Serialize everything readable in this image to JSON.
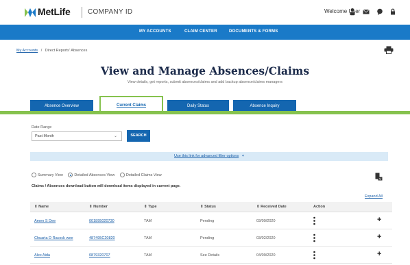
{
  "header": {
    "brand": "MetLife",
    "product": "COMPANY ID",
    "welcome": "Welcome User",
    "brand_colors": {
      "blue": "#1a7ac8",
      "green": "#86c24e"
    },
    "icons": [
      "user-icon",
      "mail-icon",
      "chat-icon",
      "lock-icon"
    ]
  },
  "nav": {
    "items": [
      "MY ACCOUNTS",
      "CLAIM CENTER",
      "DOCUMENTS & FORMS"
    ]
  },
  "breadcrumb": {
    "root": "My Accounts",
    "separator": "/",
    "current": "Direct Reports' Absences"
  },
  "page": {
    "title": "View and Manage Absences/Claims",
    "subtitle": "View details, get reports, submit absences/claims and add backup absence/claims managers"
  },
  "tabs": [
    {
      "label": "Absence Overview",
      "active": false
    },
    {
      "label": "Current Claims",
      "active": true
    },
    {
      "label": "Daily Status",
      "active": false
    },
    {
      "label": "Absence Inquiry",
      "active": false
    }
  ],
  "filters": {
    "date_range_label": "Date Range",
    "date_range_value": "Past Month",
    "search_label": "SEARCH",
    "advanced_link": "Use this link for advanced filter options",
    "advanced_icon": "+"
  },
  "views": {
    "options": [
      "Summary View",
      "Detailed Absences View",
      "Detailed Claims View"
    ],
    "selected": "Detailed Absences View"
  },
  "note": "Claims / Absences download button will download items displayed in current page.",
  "expand_all": "Expand All",
  "table": {
    "headers": [
      "Name",
      "Number",
      "Type",
      "Status",
      "Received Date",
      "Action"
    ],
    "sort_glyph": "⇕",
    "rows": [
      {
        "name": "Amen S Dee",
        "number": "001895020730",
        "type": "TAM",
        "status": "Pending",
        "received": "03/09/2020"
      },
      {
        "name": "Chuarta D Racock wee",
        "number": "487495C20820",
        "type": "TAM",
        "status": "Pending",
        "received": "03/02/2020"
      },
      {
        "name": "Alex Aida",
        "number": "0879320707",
        "type": "TAM",
        "status": "See Details",
        "received": "04/09/2020"
      }
    ]
  }
}
